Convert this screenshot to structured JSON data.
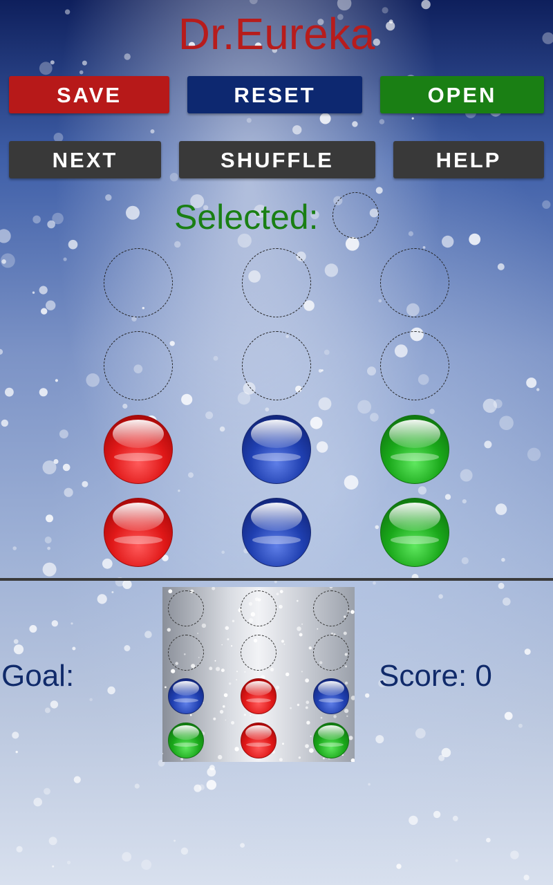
{
  "app": {
    "title": "Dr.Eureka"
  },
  "toolbar": {
    "save_label": "SAVE",
    "reset_label": "RESET",
    "open_label": "OPEN",
    "next_label": "NEXT",
    "shuffle_label": "SHUFFLE",
    "help_label": "HELP"
  },
  "colors": {
    "title": "#b71c1c",
    "save": "#b71919",
    "reset": "#0d2870",
    "open": "#1a7f14",
    "secondary_button": "#393939",
    "selected_text": "#1a7f14",
    "goal_text": "#102a6a"
  },
  "selected": {
    "label": "Selected:",
    "ball": null
  },
  "board": {
    "columns": 3,
    "rows_top_to_bottom": [
      [
        "empty",
        "empty",
        "empty"
      ],
      [
        "empty",
        "empty",
        "empty"
      ],
      [
        "red",
        "blue",
        "green"
      ],
      [
        "red",
        "blue",
        "green"
      ]
    ]
  },
  "goal": {
    "label": "Goal:",
    "rows_top_to_bottom": [
      [
        "empty",
        "empty",
        "empty"
      ],
      [
        "empty",
        "empty",
        "empty"
      ],
      [
        "blue",
        "red",
        "blue"
      ],
      [
        "green",
        "red",
        "green"
      ]
    ]
  },
  "score": {
    "label": "Score:",
    "value": "0"
  }
}
